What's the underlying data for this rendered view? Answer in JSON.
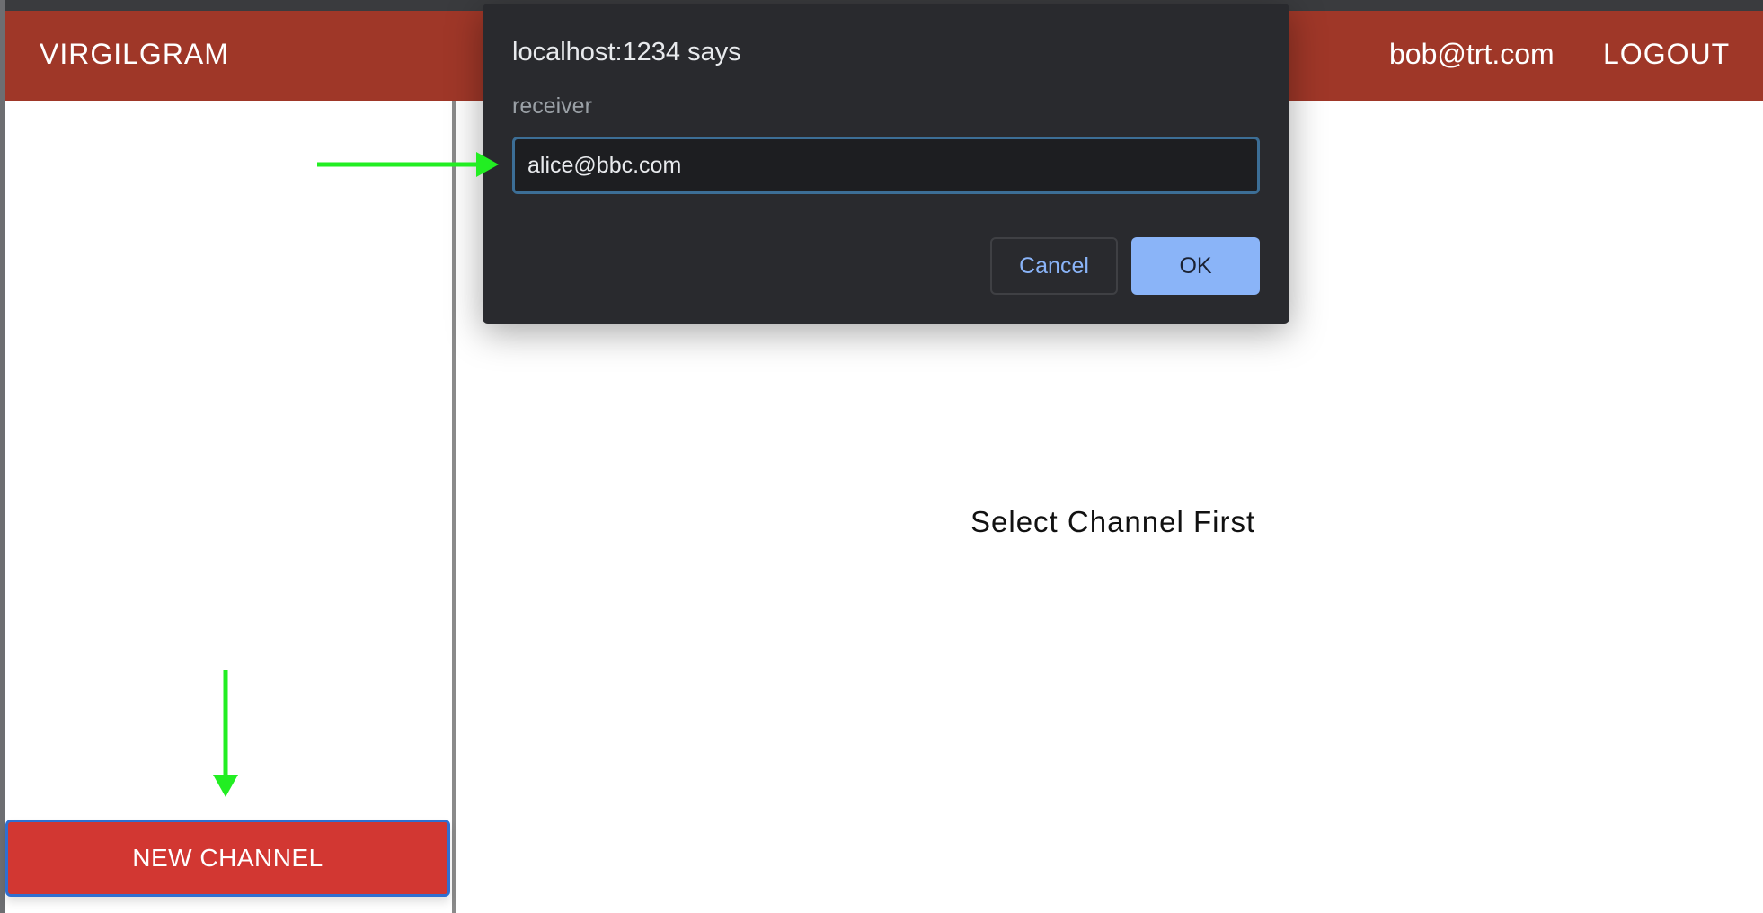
{
  "app": {
    "brand": "VIRGILGRAM",
    "user_email": "bob@trt.com",
    "logout_label": "LOGOUT"
  },
  "sidebar": {
    "new_channel_label": "NEW CHANNEL"
  },
  "main": {
    "placeholder_message": "Select Channel First"
  },
  "dialog": {
    "title": "localhost:1234 says",
    "message": "receiver",
    "input_value": "alice@bbc.com",
    "cancel_label": "Cancel",
    "ok_label": "OK"
  },
  "colors": {
    "header": "#9f3728",
    "new_channel_button": "#d23732",
    "dialog_bg": "#292a2e",
    "dialog_accent": "#8ab4f8",
    "annotation_arrow": "#22ee22"
  }
}
